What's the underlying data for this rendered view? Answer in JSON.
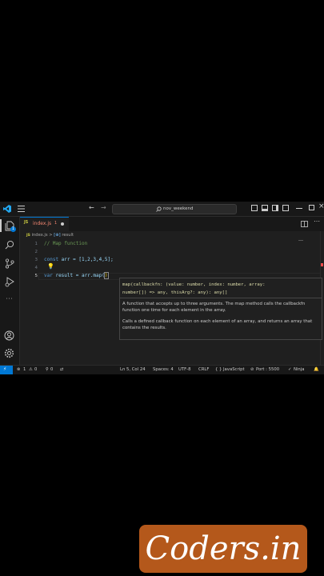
{
  "titlebar": {
    "back_icon": "arrow-left-icon",
    "forward_icon": "arrow-right-icon",
    "search_value": "nov_weekend"
  },
  "activity": {
    "explorer_badge": "1"
  },
  "tab": {
    "lang": "JS",
    "filename": "index.js",
    "number": "1"
  },
  "breadcrumb": {
    "lang": "JS",
    "file": "index.js",
    "sep": ">",
    "symbol_icon": "[⊕]",
    "symbol": "result"
  },
  "editor": {
    "lines": [
      {
        "n": "1",
        "text": "// Map function"
      },
      {
        "n": "2",
        "text": ""
      },
      {
        "n": "3",
        "text": "const arr = [1,2,3,4,5];"
      },
      {
        "n": "4",
        "text": ""
      },
      {
        "n": "5",
        "text": "var result = arr.map()"
      }
    ],
    "line3": {
      "kw": "const",
      "rest": " arr = [1,2,3,4,5];"
    },
    "line5": {
      "kw": "var",
      "rest": " result = arr.map(",
      "close": ")"
    }
  },
  "hover": {
    "sig_line1": "map(callbackfn: (value: number, index: number, array:",
    "sig_line2": "number[]) => any, thisArg?: any): any[]",
    "desc1": "A function that accepts up to three arguments. The map method calls the callbackfn function one time for each element in the array.",
    "desc2": "Calls a defined callback function on each element of an array, and returns an array that contains the results."
  },
  "status": {
    "errors": "1",
    "warnings": "0",
    "infos": "0",
    "position": "Ln 5, Col 24",
    "spaces": "Spaces: 4",
    "encoding": "UTF-8",
    "eol": "CRLF",
    "language": "JavaScript",
    "port": "Port : 5500",
    "ninja": "Ninja"
  },
  "logo": {
    "text": "Coders.in"
  },
  "colors": {
    "accent": "#0078d4",
    "keyword": "#569cd6",
    "comment": "#6a9955",
    "number": "#b5cea8",
    "js_yellow": "#cbcb41",
    "tab_file_red": "#f48771",
    "brand_orange": "#b4581b"
  }
}
